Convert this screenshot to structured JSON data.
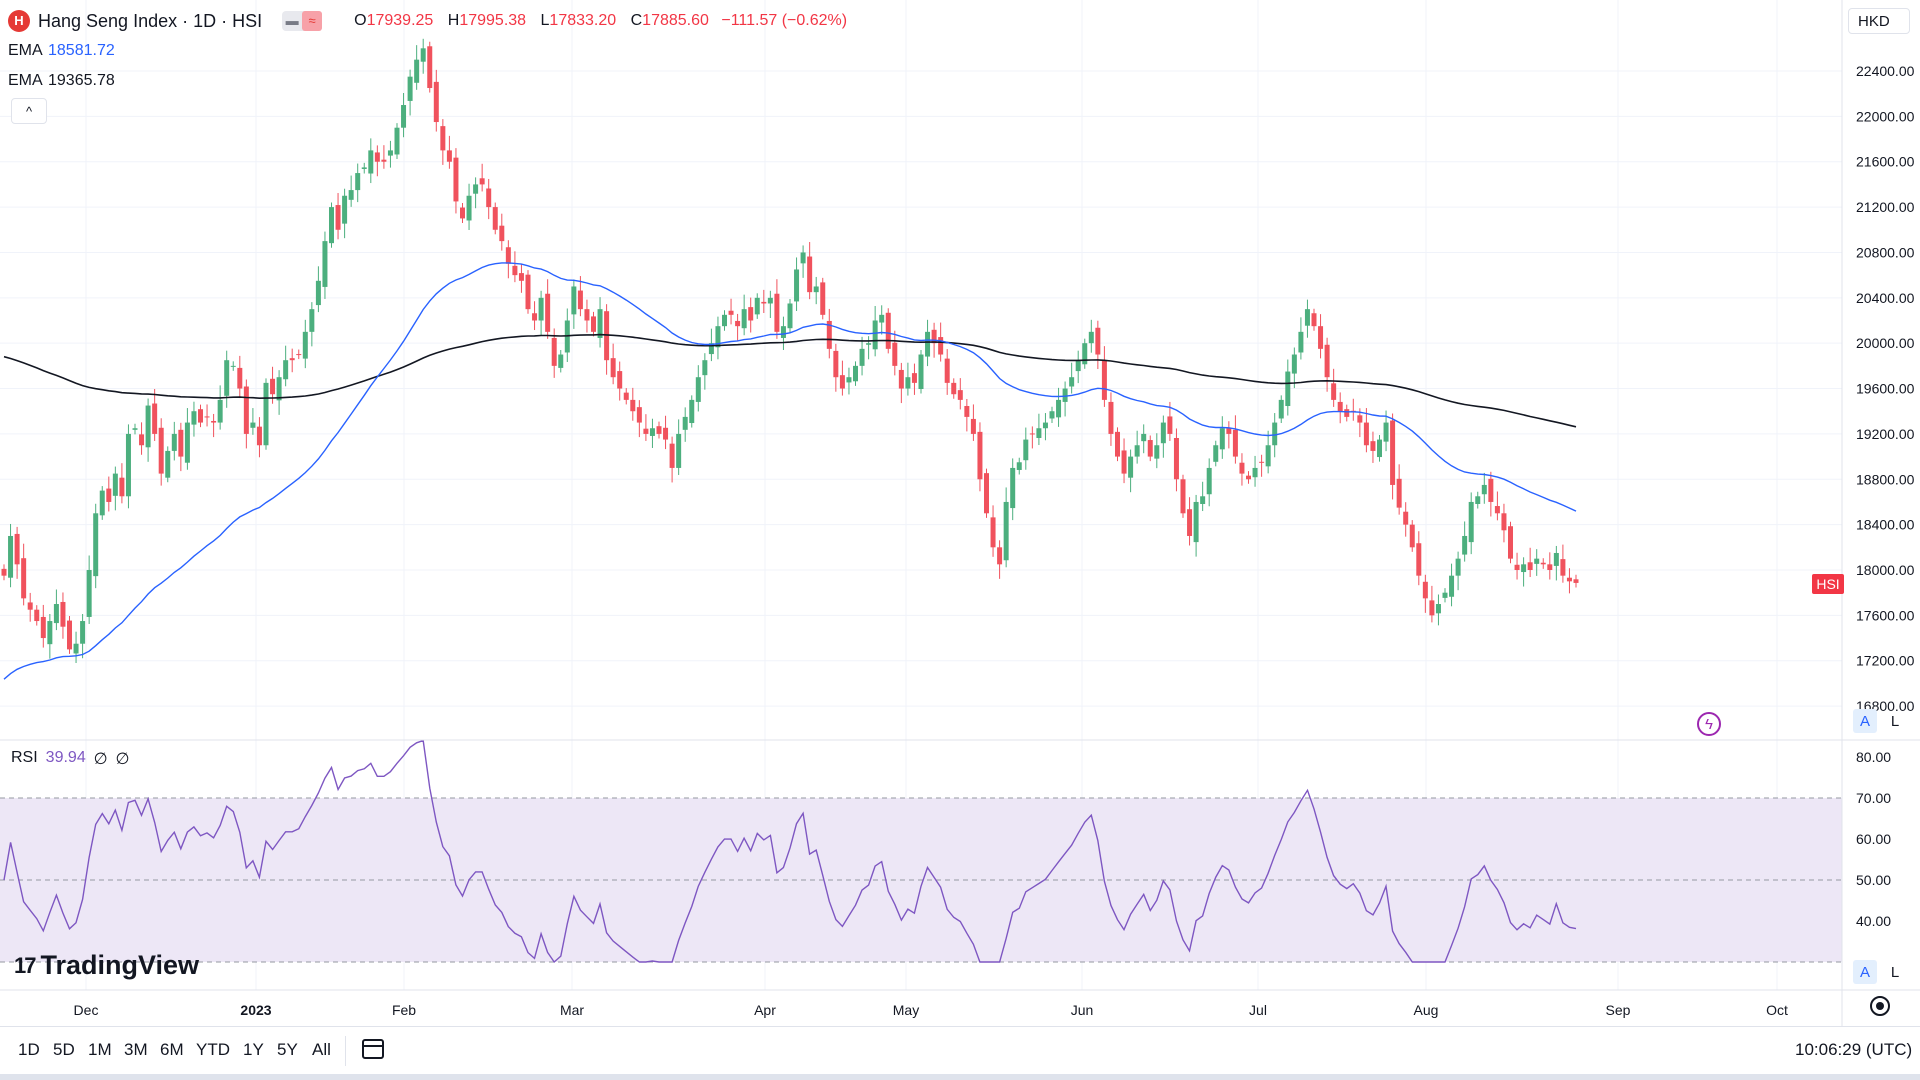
{
  "header": {
    "logo_letter": "H",
    "title": "Hang Seng Index · 1D · HSI",
    "toggle_left": "▬",
    "toggle_right": "≈",
    "ohlc": [
      {
        "k": "O",
        "v": "17939.25"
      },
      {
        "k": "H",
        "v": "17995.38"
      },
      {
        "k": "L",
        "v": "17833.20"
      },
      {
        "k": "C",
        "v": "17885.60"
      }
    ],
    "change": "−111.57 (−0.62%)"
  },
  "indicators": [
    {
      "label": "EMA",
      "value": "18581.72",
      "color": "#2962ff"
    },
    {
      "label": "EMA",
      "value": "19365.78",
      "color": "#131722"
    }
  ],
  "collapse_label": "^",
  "currency": "HKD",
  "price_tag": "HSI",
  "scale_buttons": {
    "auto": "A",
    "log": "L"
  },
  "rsi": {
    "label": "RSI",
    "value": "39.94",
    "extra1": "∅",
    "extra2": "∅"
  },
  "logo_text": "TradingView",
  "logo_mark": "17",
  "ranges": [
    "1D",
    "5D",
    "1M",
    "3M",
    "6M",
    "YTD",
    "1Y",
    "5Y",
    "All"
  ],
  "clock": "10:06:29 (UTC)",
  "colors": {
    "up": "#4caf7e",
    "down": "#f0525d",
    "ema50": "#2962ff",
    "ema200": "#131722",
    "rsi": "#7e57c2",
    "rsi_band": "#ede7f6"
  },
  "chart_data": [
    {
      "type": "candlestick",
      "series_name": "HSI",
      "y_ticks": [
        16800,
        17200,
        17600,
        18000,
        18400,
        18800,
        19200,
        19600,
        20000,
        20400,
        20800,
        21200,
        21600,
        22000,
        22400
      ],
      "y_tick_labels": [
        "16800.00",
        "17200.00",
        "17600.00",
        "18000.00",
        "18400.00",
        "18800.00",
        "19200.00",
        "19600.00",
        "20000.00",
        "20400.00",
        "20800.00",
        "21200.00",
        "21600.00",
        "22000.00",
        "22400.00"
      ],
      "ylim": [
        16800,
        22800
      ],
      "x_ticks": [
        "Dec",
        "2023",
        "Feb",
        "Mar",
        "Apr",
        "May",
        "Jun",
        "Jul",
        "Aug",
        "Sep",
        "Oct"
      ],
      "close": [
        17950,
        18300,
        18050,
        17750,
        17650,
        17550,
        17400,
        17550,
        17700,
        17500,
        17300,
        17350,
        17550,
        18000,
        18500,
        18700,
        18600,
        18850,
        18650,
        19200,
        19250,
        19100,
        19450,
        19200,
        18850,
        19050,
        19200,
        19000,
        19300,
        19400,
        19300,
        19350,
        19300,
        19500,
        19850,
        19800,
        19600,
        19200,
        19300,
        19100,
        19650,
        19550,
        19700,
        19850,
        19850,
        19900,
        20100,
        20300,
        20550,
        20900,
        21200,
        21000,
        21300,
        21350,
        21500,
        21550,
        21700,
        21600,
        21600,
        21700,
        21900,
        22100,
        22350,
        22500,
        22600,
        22250,
        21950,
        21700,
        21600,
        21250,
        21100,
        21300,
        21400,
        21400,
        21200,
        21000,
        20900,
        20700,
        20600,
        20550,
        20300,
        20200,
        20400,
        20100,
        19800,
        19900,
        20200,
        20500,
        20300,
        20200,
        20100,
        20300,
        19850,
        19700,
        19600,
        19500,
        19400,
        19300,
        19200,
        19250,
        19200,
        19150,
        18900,
        19200,
        19350,
        19500,
        19700,
        19850,
        20000,
        20150,
        20250,
        20250,
        20150,
        20300,
        20200,
        20400,
        20350,
        20400,
        20100,
        20150,
        20350,
        20650,
        20800,
        20450,
        20500,
        20250,
        19950,
        19700,
        19600,
        19700,
        19800,
        19950,
        20000,
        20200,
        20250,
        19950,
        19800,
        19600,
        19700,
        19650,
        19900,
        20100,
        20000,
        19900,
        19650,
        19550,
        19500,
        19350,
        19200,
        18800,
        18500,
        18200,
        18050,
        18600,
        18900,
        18950,
        19150,
        19200,
        19250,
        19300,
        19400,
        19500,
        19600,
        19700,
        19850,
        20000,
        20100,
        19900,
        19500,
        19200,
        19000,
        18850,
        19000,
        19100,
        19200,
        19000,
        19100,
        19300,
        19200,
        18800,
        18500,
        18300,
        18600,
        18650,
        18900,
        19100,
        19250,
        19200,
        19000,
        18850,
        18800,
        18900,
        18950,
        19100,
        19300,
        19500,
        19750,
        19900,
        20100,
        20300,
        20150,
        19950,
        19700,
        19500,
        19400,
        19350,
        19400,
        19300,
        19100,
        19050,
        19150,
        19300,
        18750,
        18550,
        18400,
        18200,
        17950,
        17750,
        17600,
        17700,
        17800,
        17950,
        18100,
        18300,
        18600,
        18650,
        18750,
        18600,
        18500,
        18350,
        18100,
        18000,
        18050,
        18000,
        18100,
        18050,
        18000,
        18150,
        17950,
        17900,
        17886
      ]
    },
    {
      "type": "line",
      "series_name": "RSI",
      "y_ticks": [
        40,
        50,
        60,
        70,
        80
      ],
      "y_tick_labels": [
        "40.00",
        "50.00",
        "60.00",
        "70.00",
        "80.00"
      ],
      "ylim": [
        30,
        84
      ],
      "band": [
        30,
        70
      ],
      "midline": 50
    }
  ]
}
